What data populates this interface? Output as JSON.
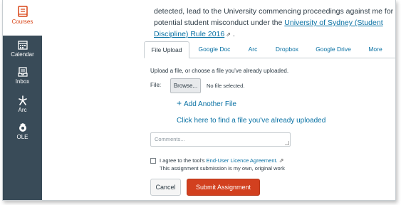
{
  "sidebar": {
    "items": [
      {
        "label": "Courses",
        "icon": "book-icon",
        "active": true
      },
      {
        "label": "Calendar",
        "icon": "calendar-icon"
      },
      {
        "label": "Inbox",
        "icon": "inbox-icon"
      },
      {
        "label": "Arc",
        "icon": "arc-icon"
      },
      {
        "label": "OLE",
        "icon": "ole-icon"
      }
    ]
  },
  "paragraph": {
    "line1": "detected, lead to the University commencing proceedings against me for",
    "line2_prefix": "potential student misconduct under the ",
    "link": "University of Sydney (Student Discipline) Rule 2016",
    "suffix": " ."
  },
  "tabs": [
    "File Upload",
    "Google Doc",
    "Arc",
    "Dropbox",
    "Google Drive",
    "More"
  ],
  "upload": {
    "instruction": "Upload a file, or choose a file you've already uploaded.",
    "file_label": "File:",
    "browse_label": "Browse...",
    "no_file": "No file selected.",
    "add_another": "Add Another File",
    "find_uploaded": "Click here to find a file you've already uploaded",
    "comments_placeholder": "Comments..."
  },
  "agreement": {
    "prefix": "I agree to the tool's ",
    "link": "End-User Licence Agreement.",
    "line2": "This assignment submission is my own, original work"
  },
  "buttons": {
    "cancel": "Cancel",
    "submit": "Submit Assignment"
  },
  "colors": {
    "sidebar_bg": "#394b58",
    "accent_red": "#d2401f",
    "link_blue": "#0770a3"
  }
}
